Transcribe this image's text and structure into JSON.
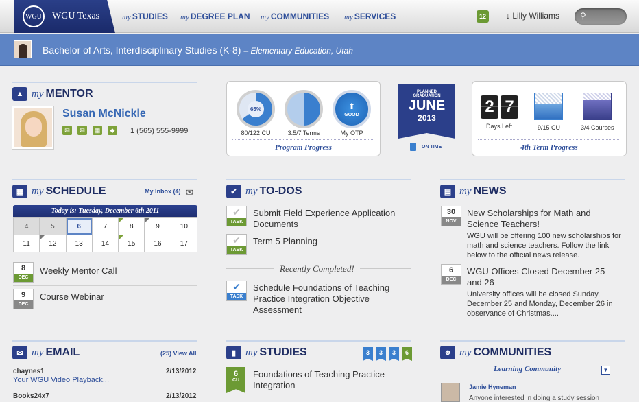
{
  "nav": {
    "logo_seal": "WGU",
    "logo": "WGU Texas",
    "items": [
      {
        "prefix": "my",
        "label": "STUDIES"
      },
      {
        "prefix": "my",
        "label": "DEGREE PLAN"
      },
      {
        "prefix": "my",
        "label": "COMMUNITIES"
      },
      {
        "prefix": "my",
        "label": "SERVICES"
      }
    ],
    "notification_count": "12",
    "user_name": "Lilly Williams"
  },
  "program": {
    "title": "Bachelor of Arts, Interdisciplinary Studies (K-8)",
    "subtitle": "– Elementary Education, Utah"
  },
  "mentor": {
    "heading_prefix": "my",
    "heading": "MENTOR",
    "name": "Susan McNickle",
    "phone": "1 (565) 555-9999"
  },
  "program_progress": {
    "percent_label": "65%",
    "percent": 0.65,
    "cu_label": "80/122 CU",
    "terms_label": "3.5/7 Terms",
    "otp_badge": "GOOD",
    "otp_label": "My OTP",
    "footer": "Program Progress"
  },
  "graduation": {
    "line1": "PLANNED",
    "line2": "GRADUATION",
    "month": "JUNE",
    "year": "2013",
    "status": "ON TIME"
  },
  "term_progress": {
    "days_digit1": "2",
    "days_digit2": "7",
    "days_label": "Days Left",
    "cu_label": "9/15 CU",
    "cu_fraction": 0.6,
    "courses_label": "3/4 Courses",
    "courses_fraction": 0.75,
    "footer": "4th Term Progress"
  },
  "schedule": {
    "heading_prefix": "my",
    "heading": "SCHEDULE",
    "inbox": "My Inbox (4)",
    "today": "Today is: Tuesday, December 6th 2011",
    "days": [
      "4",
      "5",
      "6",
      "7",
      "8",
      "9",
      "10",
      "11",
      "12",
      "13",
      "14",
      "15",
      "16",
      "17"
    ],
    "events": [
      {
        "day": "8",
        "month": "DEC",
        "title": "Weekly Mentor Call"
      },
      {
        "day": "9",
        "month": "DEC",
        "title": "Course Webinar"
      }
    ]
  },
  "todos": {
    "heading_prefix": "my",
    "heading": "TO-DOS",
    "task_label": "TASK",
    "items": [
      {
        "title": "Submit Field Experience Application Documents"
      },
      {
        "title": "Term 5 Planning"
      }
    ],
    "completed_label": "Recently Completed!",
    "completed": [
      {
        "title": "Schedule Foundations of Teaching Practice Integration Objective Assessment"
      }
    ]
  },
  "news": {
    "heading_prefix": "my",
    "heading": "NEWS",
    "items": [
      {
        "day": "30",
        "month": "NOV",
        "title": "New Scholarships for Math and Science Teachers!",
        "body": "WGU will be offering 100 new scholarships for math and science teachers. Follow the link below to the official news release."
      },
      {
        "day": "6",
        "month": "DEC",
        "title": "WGU Offices Closed December 25 and 26",
        "body": "University offices will be closed Sunday, December 25 and Monday, December 26 in observance of Christmas...."
      }
    ]
  },
  "email": {
    "heading_prefix": "my",
    "heading": "EMAIL",
    "view_all": "(25) View All",
    "items": [
      {
        "from": "chaynes1",
        "date": "2/13/2012",
        "subject": "Your WGU Video Playback..."
      },
      {
        "from": "Books24x7",
        "date": "2/13/2012",
        "subject": ""
      }
    ]
  },
  "studies": {
    "heading_prefix": "my",
    "heading": "STUDIES",
    "badges": [
      "3",
      "3",
      "3",
      "6"
    ],
    "course": {
      "cu": "6",
      "cu_label": "CU",
      "title": "Foundations of Teaching Practice Integration"
    }
  },
  "communities": {
    "heading_prefix": "my",
    "heading": "COMMUNITIES",
    "selector": "Learning Community",
    "post": {
      "author": "Jamie Hyneman",
      "text": "Anyone interested in doing a study session"
    }
  },
  "colors": {
    "brand": "#2b3f8a",
    "accent": "#5d84c5",
    "green": "#6c9a34"
  }
}
